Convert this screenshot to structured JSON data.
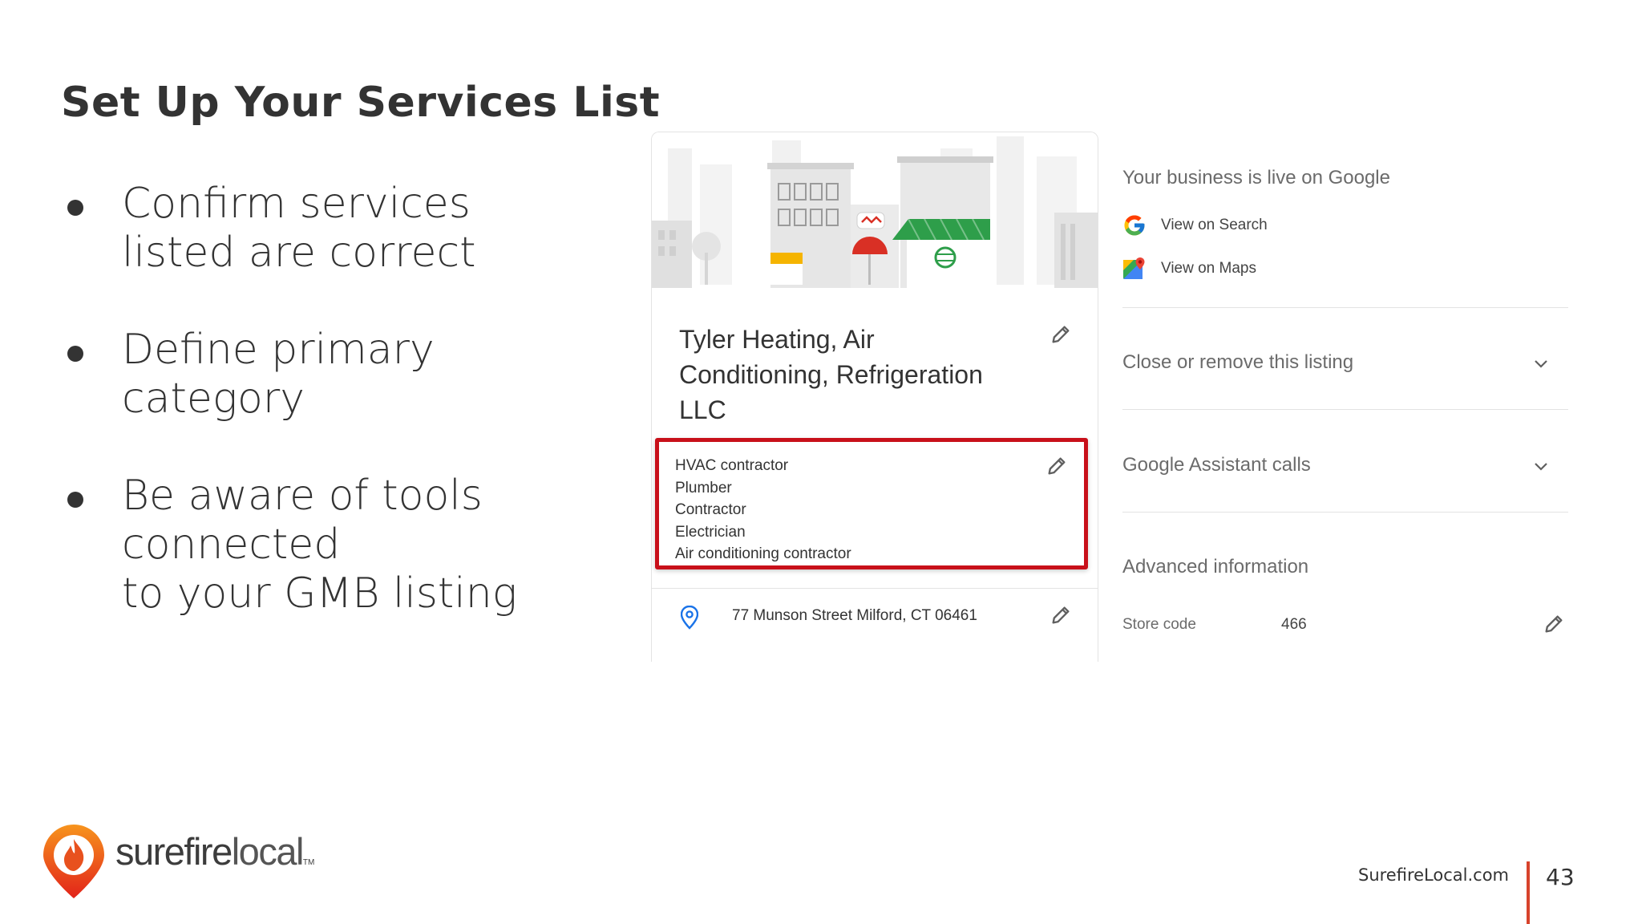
{
  "slide": {
    "title": "Set Up Your Services List",
    "bullets": [
      "Confirm services\nlisted are correct",
      "Define primary\ncategory",
      "Be aware of tools\nconnected\nto your GMB listing"
    ]
  },
  "listing": {
    "business_name": "Tyler Heating, Air Conditioning, Refrigeration LLC",
    "categories": [
      "HVAC contractor",
      "Plumber",
      "Contractor",
      "Electrician",
      "Air conditioning contractor"
    ],
    "address": "77 Munson Street Milford, CT 06461"
  },
  "side_panel": {
    "live_heading": "Your business is live on Google",
    "view_on_search": "View on Search",
    "view_on_maps": "View on Maps",
    "close_listing": "Close or remove this listing",
    "assistant_calls": "Google Assistant calls",
    "advanced_info": "Advanced information",
    "store_code_label": "Store code",
    "store_code_value": "466"
  },
  "footer": {
    "brand_bold": "surefire",
    "brand_light": "local",
    "brand_tm": "TM",
    "site": "SurefireLocal.com",
    "page_number": "43"
  },
  "colors": {
    "highlight_red": "#c8101a",
    "footer_accent": "#d7432c",
    "store_green": "#2e9e4a"
  }
}
